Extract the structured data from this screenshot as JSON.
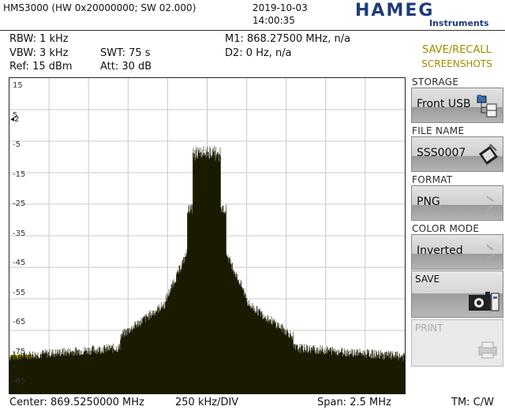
{
  "header": {
    "model": "HMS3000 (HW 0x20000000; SW 02.000)",
    "date": "2019-10-03",
    "time": "14:00:35",
    "logo": "HAMEG",
    "logo_sub": "Instruments"
  },
  "settings": {
    "rbw": "RBW: 1 kHz",
    "vbw": "VBW: 3 kHz",
    "ref": "Ref: 15 dBm",
    "swt": "SWT: 75 s",
    "att": "Att: 30 dB",
    "m1": "M1: 868.27500 MHz, n/a",
    "d2": "D2: 0 Hz, n/a"
  },
  "menu": {
    "title_line1": "SAVE/RECALL",
    "title_line2": "SCREENSHOTS",
    "storage_label": "STORAGE",
    "storage_value": "Front USB",
    "filename_label": "FILE NAME",
    "filename_value": "SSS0007",
    "format_label": "FORMAT",
    "format_value": "PNG",
    "colormode_label": "COLOR MODE",
    "colormode_value": "Inverted",
    "save_label": "SAVE",
    "print_label": "PRINT"
  },
  "plot": {
    "y_ticks": [
      "15",
      "5",
      "-5",
      "-15",
      "-25",
      "-35",
      "-45",
      "-55",
      "-65",
      "-75",
      "-85"
    ],
    "marker_label": "2",
    "trace_color": "#1a1a00",
    "grid_color": "#c8c8c8",
    "low_label_bg": "#b8a400"
  },
  "footer": {
    "center": "Center: 869.5250000 MHz",
    "div": "250 kHz/DIV",
    "span": "Span: 2.5 MHz",
    "tm": "TM: C/W"
  }
}
